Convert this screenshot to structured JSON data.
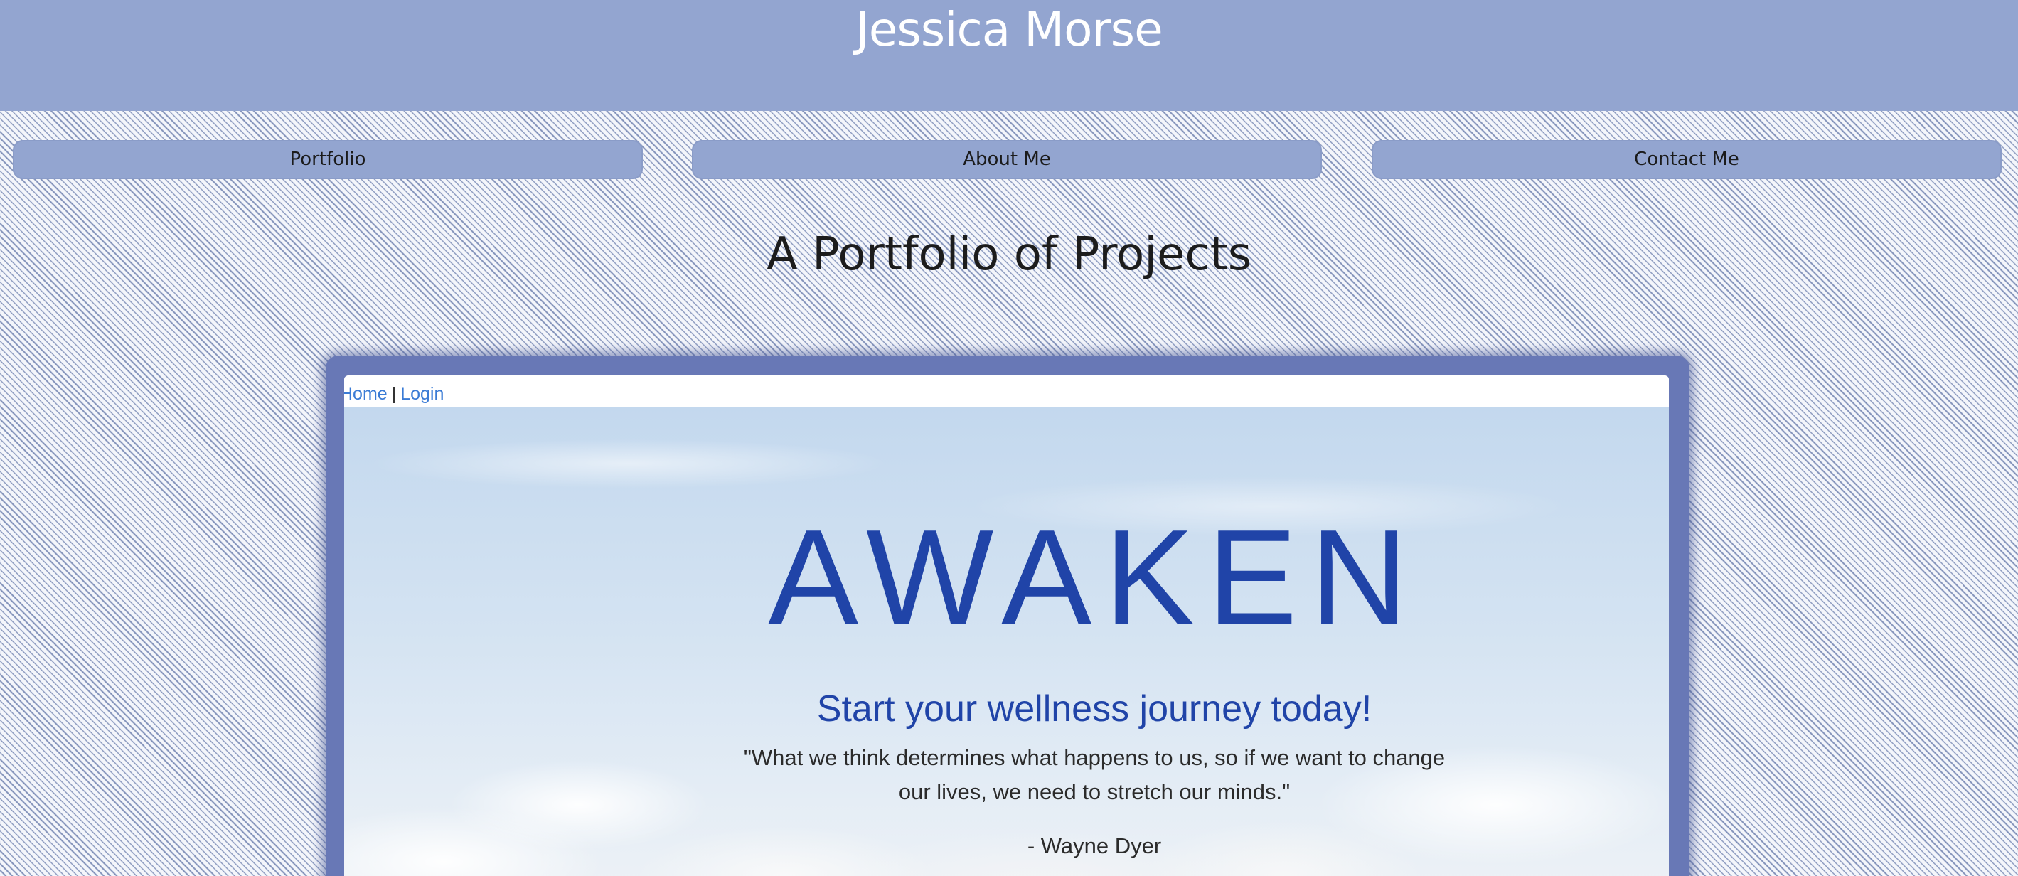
{
  "header": {
    "title": "Jessica Morse"
  },
  "nav": {
    "items": [
      {
        "label": "Portfolio"
      },
      {
        "label": "About Me"
      },
      {
        "label": "Contact Me"
      }
    ]
  },
  "main": {
    "title": "A Portfolio of Projects"
  },
  "project": {
    "nav": {
      "home": "Home",
      "separator": "|",
      "login": "Login"
    },
    "logo": "AWAKEN",
    "tagline": "Start your wellness journey today!",
    "quote": "\"What we think determines what happens to us, so if we want to change our lives, we need to stretch our minds.\"",
    "author": "- Wayne Dyer"
  },
  "colors": {
    "header_bg": "#93a5d0",
    "frame": "#6878b6",
    "accent_blue": "#2044a8",
    "link": "#3a7bd5"
  }
}
